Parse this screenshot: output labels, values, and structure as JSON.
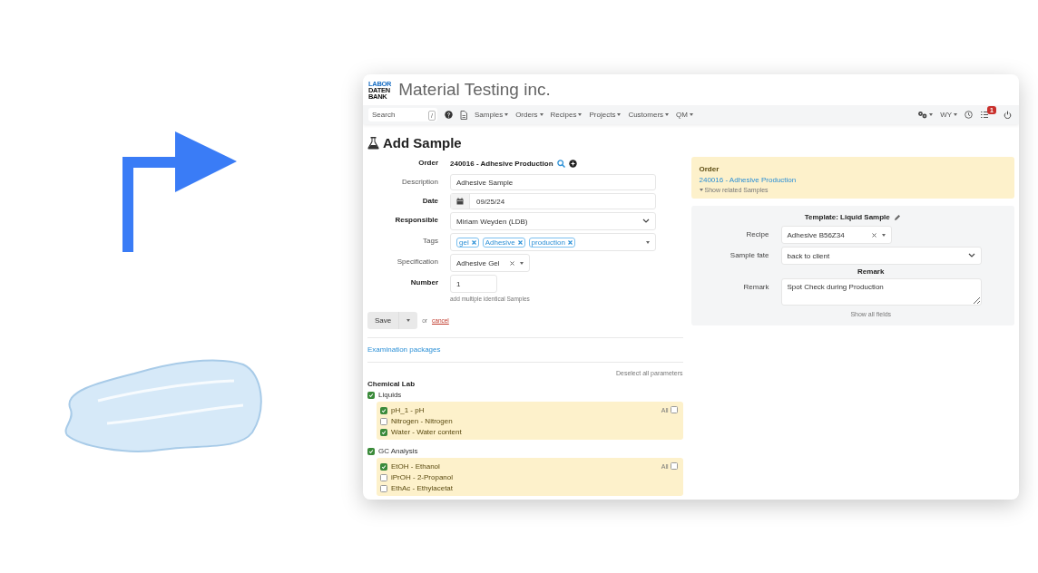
{
  "header": {
    "logo_lines": [
      "LABOR",
      "DATEN",
      "BANK"
    ],
    "title": "Material Testing inc."
  },
  "navbar": {
    "search": {
      "placeholder": "Search",
      "shortcut": "/"
    },
    "menus": [
      {
        "label": "Samples"
      },
      {
        "label": "Orders"
      },
      {
        "label": "Recipes"
      },
      {
        "label": "Projects"
      },
      {
        "label": "Customers"
      },
      {
        "label": "QM"
      }
    ],
    "user": "WY",
    "notification_count": "1"
  },
  "page_title": "Add Sample",
  "form": {
    "fields": [
      {
        "kind": "static",
        "label": "Order",
        "bold": true,
        "value": "240016 - Adhesive Production"
      },
      {
        "kind": "text",
        "label": "Description",
        "bold": false,
        "value": "Adhesive Sample"
      },
      {
        "kind": "date",
        "label": "Date",
        "bold": true,
        "value": "09/25/24"
      },
      {
        "kind": "select",
        "label": "Responsible",
        "bold": true,
        "value": "Miriam Weyden (LDB)"
      },
      {
        "kind": "tags",
        "label": "Tags",
        "bold": false,
        "tags": [
          "gel",
          "Adhesive",
          "production"
        ]
      },
      {
        "kind": "clearable",
        "label": "Specification",
        "bold": false,
        "value": "Adhesive Gel"
      },
      {
        "kind": "number",
        "label": "Number",
        "bold": true,
        "value": "1",
        "hint": "add multiple identical Samples"
      }
    ],
    "save": "Save",
    "or": "or",
    "cancel": "cancel"
  },
  "packages_link": "Examination packages",
  "parameters": {
    "deselect": "Deselect all parameters",
    "labs": [
      {
        "name": "Chemical Lab",
        "groups": [
          {
            "label": "Liquids",
            "checked": true,
            "all_label": "All",
            "all_checked": false,
            "params": [
              {
                "label": "pH_1 - pH",
                "checked": true
              },
              {
                "label": "Nitrogen - Nitrogen",
                "checked": false
              },
              {
                "label": "Water - Water content",
                "checked": true
              }
            ]
          },
          {
            "label": "GC Analysis",
            "checked": true,
            "all_label": "All",
            "all_checked": false,
            "params": [
              {
                "label": "EtOH - Ethanol",
                "checked": true
              },
              {
                "label": "iPrOH - 2-Propanol",
                "checked": false
              },
              {
                "label": "EthAc - Ethylacetat",
                "checked": false
              }
            ]
          }
        ]
      }
    ]
  },
  "order_card": {
    "title": "Order",
    "link": "240016 - Adhesive Production",
    "toggle": "Show related Samples"
  },
  "template_card": {
    "title": "Template: Liquid Sample",
    "fields": [
      {
        "kind": "clearable",
        "label": "Recipe",
        "value": "Adhesive B56Z34"
      },
      {
        "kind": "select",
        "label": "Sample fate",
        "value": "back to client"
      },
      {
        "kind": "heading",
        "label": "Remark"
      },
      {
        "kind": "textarea",
        "label": "Remark",
        "value": "Spot Check during Production"
      }
    ],
    "show_all": "Show all fields"
  }
}
